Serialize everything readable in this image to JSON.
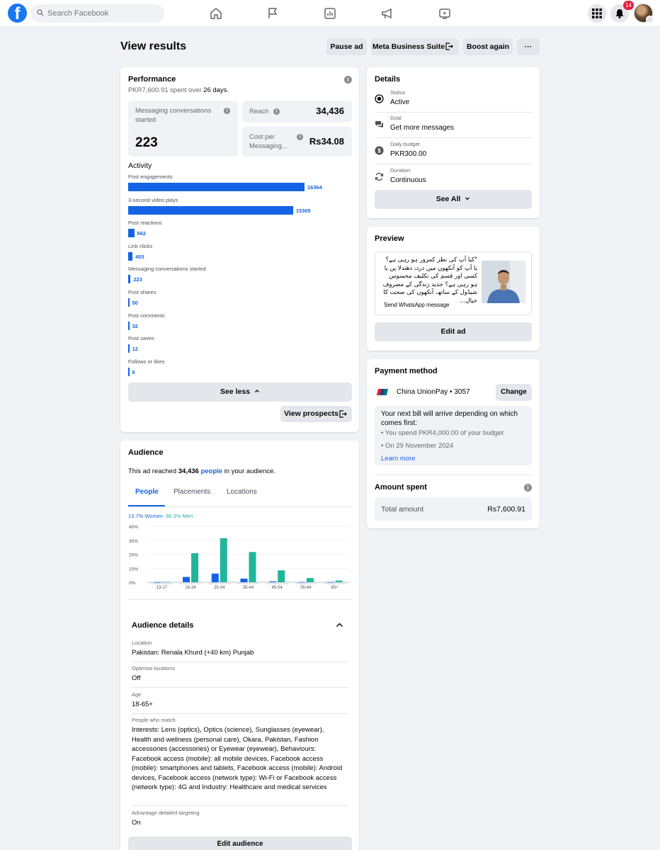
{
  "topnav": {
    "logo": "f",
    "search_placeholder": "Search Facebook",
    "notification_count": "14",
    "icons": [
      "home-icon",
      "flag-icon",
      "insights-icon",
      "megaphone-icon",
      "video-icon",
      "menu-grid-icon",
      "bell-icon"
    ]
  },
  "header": {
    "title": "View results",
    "buttons": {
      "pause": "Pause ad",
      "meta": "Meta Business Suite",
      "boost": "Boost again",
      "more": "···"
    }
  },
  "performance": {
    "title": "Performance",
    "spent_prefix": "PKR7,600.91",
    "spent_middle": " spent over ",
    "spent_days": "26 days",
    "spent_suffix": ".",
    "msg_label": "Messaging conversations started",
    "msg_value": "223",
    "reach_label": "Reach",
    "reach_value": "34,436",
    "cpm_label": "Cost per Messaging...",
    "cpm_value": "Rs34.08",
    "activity_title": "Activity",
    "activity": [
      {
        "label": "Post engagements",
        "value": 16364
      },
      {
        "label": "3-second video plays",
        "value": 15305
      },
      {
        "label": "Post reactions",
        "value": 562
      },
      {
        "label": "Link clicks",
        "value": 403
      },
      {
        "label": "Messaging conversations started",
        "value": 223
      },
      {
        "label": "Post shares",
        "value": 50
      },
      {
        "label": "Post comments",
        "value": 32
      },
      {
        "label": "Post saves",
        "value": 12
      },
      {
        "label": "Follows or likes",
        "value": 6
      }
    ],
    "see_less": "See less",
    "view_prospects": "View prospects"
  },
  "details": {
    "title": "Details",
    "rows": [
      {
        "label": "Status",
        "value": "Active"
      },
      {
        "label": "Goal",
        "value": "Get more messages"
      },
      {
        "label": "Daily budget",
        "value": "PKR300.00"
      },
      {
        "label": "Duration",
        "value": "Continuous"
      }
    ],
    "see_all": "See All"
  },
  "preview": {
    "title": "Preview",
    "ad_text": "\"کیا آپ کی نظر کمزور ہو رہی ہے؟ یا آپ کو آنکھوں میں درد، دھندلا پن یا کسی اور قسم کی تکلیف محسوس ہو رہی ہے؟ جدید زندگی کے مصروف شیڈول کے ساتھ، آنکھوں کی صحت کا خیال...",
    "cta": "Send WhatsApp message",
    "edit_ad": "Edit ad"
  },
  "payment": {
    "title": "Payment method",
    "card": "China UnionPay • 3057",
    "change": "Change",
    "note_title": "Your next bill will arrive depending on which comes first:",
    "bullets": [
      "You spend PKR4,000.00 of your budget",
      "On 29 November 2024"
    ],
    "learn_more": "Learn more"
  },
  "amount": {
    "title": "Amount spent",
    "total_label": "Total amount",
    "total_value": "Rs7,600.91"
  },
  "audience": {
    "title": "Audience",
    "reach_prefix": "This ad reached ",
    "reach_count": "34,436",
    "reach_link": "people",
    "reach_suffix": " in your audience.",
    "tabs": [
      "People",
      "Placements",
      "Locations"
    ],
    "women_legend": "13.7% Women",
    "men_legend": "86.3% Men",
    "details_title": "Audience details",
    "detail_rows": [
      {
        "label": "Location",
        "value": "Pakistan: Renala Khurd (+40 km) Punjab"
      },
      {
        "label": "Optimise locations",
        "value": "Off"
      },
      {
        "label": "Age",
        "value": "18-65+"
      },
      {
        "label": "People who match",
        "value": "Interests: Lens (optics), Optics (science), Sunglasses (eyewear), Health and wellness (personal care), Okara, Pakistan, Fashion accessories (accessories) or Eyewear (eyewear), Behaviours: Facebook access (mobile): all mobile devices, Facebook access (mobile): smartphones and tablets, Facebook access (mobile): Android devices, Facebook access (network type): Wi-Fi or Facebook access (network type): 4G and Industry: Healthcare and medical services"
      },
      {
        "label": "Advantage detailed targeting",
        "value": "On"
      }
    ],
    "edit_audience": "Edit audience"
  },
  "chart_data": {
    "type": "bar",
    "categories": [
      "13-17",
      "18-24",
      "25-34",
      "35-44",
      "45-54",
      "55-64",
      "65+"
    ],
    "series": [
      {
        "name": "Women",
        "values": [
          0.1,
          3.8,
          6.2,
          2.6,
          0.6,
          0.2,
          0.2
        ]
      },
      {
        "name": "Men",
        "values": [
          0.3,
          20.8,
          31.5,
          21.6,
          8.5,
          3.0,
          1.2
        ]
      }
    ],
    "yticks": [
      "40%",
      "30%",
      "20%",
      "10%",
      "0%"
    ],
    "ylim": [
      0,
      40
    ],
    "colors": {
      "Women": "#1463e6",
      "Men": "#20b59b"
    }
  },
  "colors": {
    "accent": "#1463e6",
    "teal": "#20b59b",
    "background": "#f0f2f5"
  }
}
